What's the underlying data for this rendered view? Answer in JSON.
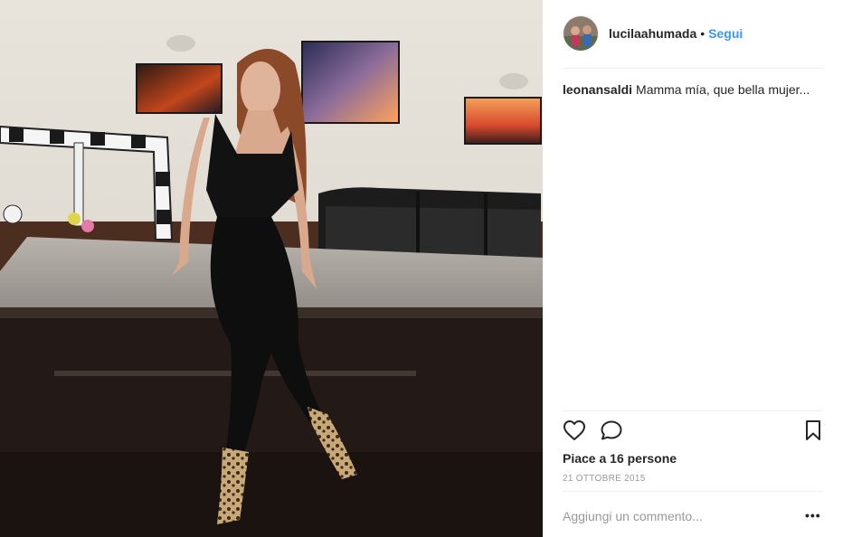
{
  "post": {
    "username": "lucilaahumada",
    "separator": "•",
    "follow_label": "Segui"
  },
  "comments": [
    {
      "user": "leonansaldi",
      "text": "Mamma mía, que bella mujer..."
    }
  ],
  "actions": {
    "like_icon": "heart-outline",
    "comment_icon": "speech-bubble",
    "save_icon": "bookmark-outline"
  },
  "likes_text": "Piace a 16 persone",
  "date_text": "21 OTTOBRE 2015",
  "comment_input": {
    "placeholder": "Aggiungi un commento..."
  },
  "more_label": "•••",
  "colors": {
    "link": "#3897f0",
    "text": "#262626",
    "muted": "#999999",
    "divider": "#efefef"
  }
}
